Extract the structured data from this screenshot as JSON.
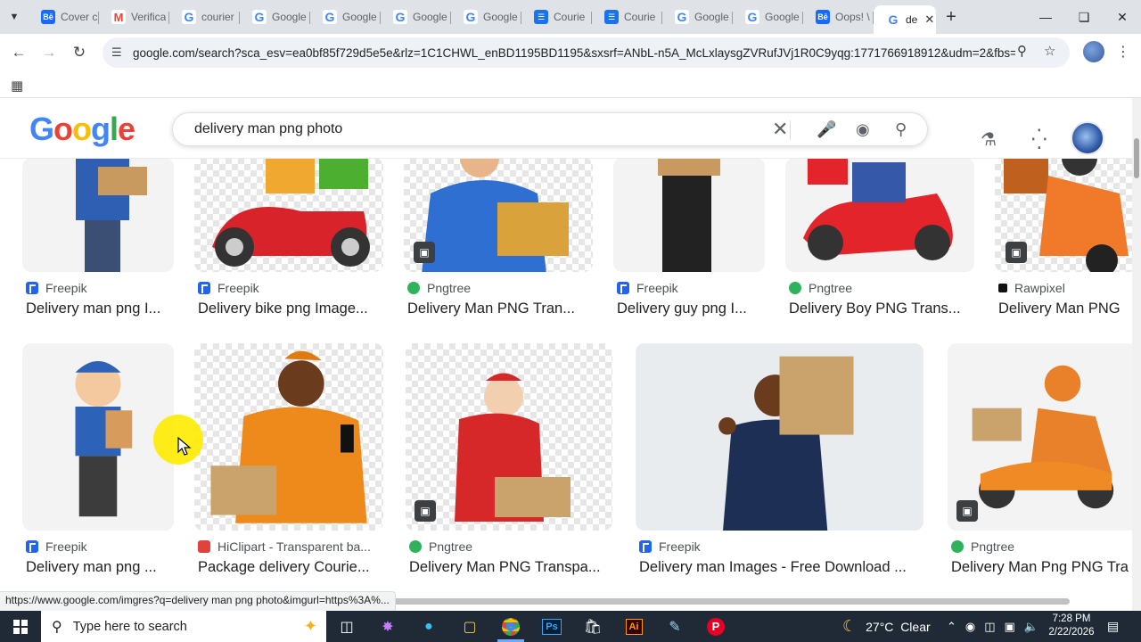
{
  "tabs": [
    {
      "label": "Cover c",
      "icon": "behance-icon"
    },
    {
      "label": "Verifica",
      "icon": "gmail-icon"
    },
    {
      "label": "courier",
      "icon": "google-icon"
    },
    {
      "label": "Google",
      "icon": "google-icon"
    },
    {
      "label": "Google",
      "icon": "google-icon"
    },
    {
      "label": "Google",
      "icon": "google-icon"
    },
    {
      "label": "Google",
      "icon": "google-icon"
    },
    {
      "label": "Courie",
      "icon": "docs-icon"
    },
    {
      "label": "Courie",
      "icon": "docs-icon"
    },
    {
      "label": "Google",
      "icon": "google-icon"
    },
    {
      "label": "Google",
      "icon": "google-icon"
    },
    {
      "label": "Oops! \\",
      "icon": "behance-icon"
    }
  ],
  "active_tab": {
    "label": "de",
    "icon": "google-icon"
  },
  "address_bar": {
    "url": "google.com/search?sca_esv=ea0bf85f729d5e5e&rlz=1C1CHWL_enBD1195BD1195&sxsrf=ANbL-n5A_McLxlaysgZVRufJVj1R0C9yqg:1771766918912&udm=2&fbs=ADc_"
  },
  "search": {
    "query": "delivery man png photo"
  },
  "logo": [
    "G",
    "o",
    "o",
    "g",
    "l",
    "e"
  ],
  "row1": [
    {
      "source": "Freepik",
      "fav": "fp",
      "title": "Delivery man png I..."
    },
    {
      "source": "Freepik",
      "fav": "fp",
      "title": "Delivery bike png Image..."
    },
    {
      "source": "Pngtree",
      "fav": "pt",
      "title": "Delivery Man PNG Tran..."
    },
    {
      "source": "Freepik",
      "fav": "fp",
      "title": "Delivery guy png I..."
    },
    {
      "source": "Pngtree",
      "fav": "pt",
      "title": "Delivery Boy PNG Trans..."
    },
    {
      "source": "Rawpixel",
      "fav": "rp",
      "title": "Delivery Man PNG"
    }
  ],
  "row2": [
    {
      "source": "Freepik",
      "fav": "fp",
      "title": "Delivery man png ..."
    },
    {
      "source": "HiClipart - Transparent ba...",
      "fav": "hc",
      "title": "Package delivery Courie..."
    },
    {
      "source": "Pngtree",
      "fav": "pt",
      "title": "Delivery Man PNG Transpa..."
    },
    {
      "source": "Freepik",
      "fav": "fp",
      "title": "Delivery man Images - Free Download ..."
    },
    {
      "source": "Pngtree",
      "fav": "pt",
      "title": "Delivery Man Png PNG Tra"
    }
  ],
  "status_url": "https://www.google.com/imgres?q=delivery man png photo&imgurl=https%3A%...",
  "taskbar": {
    "search_placeholder": "Type here to search",
    "weather": "27°C  Clear",
    "time": "7:28 PM",
    "date": "2/22/2026"
  }
}
